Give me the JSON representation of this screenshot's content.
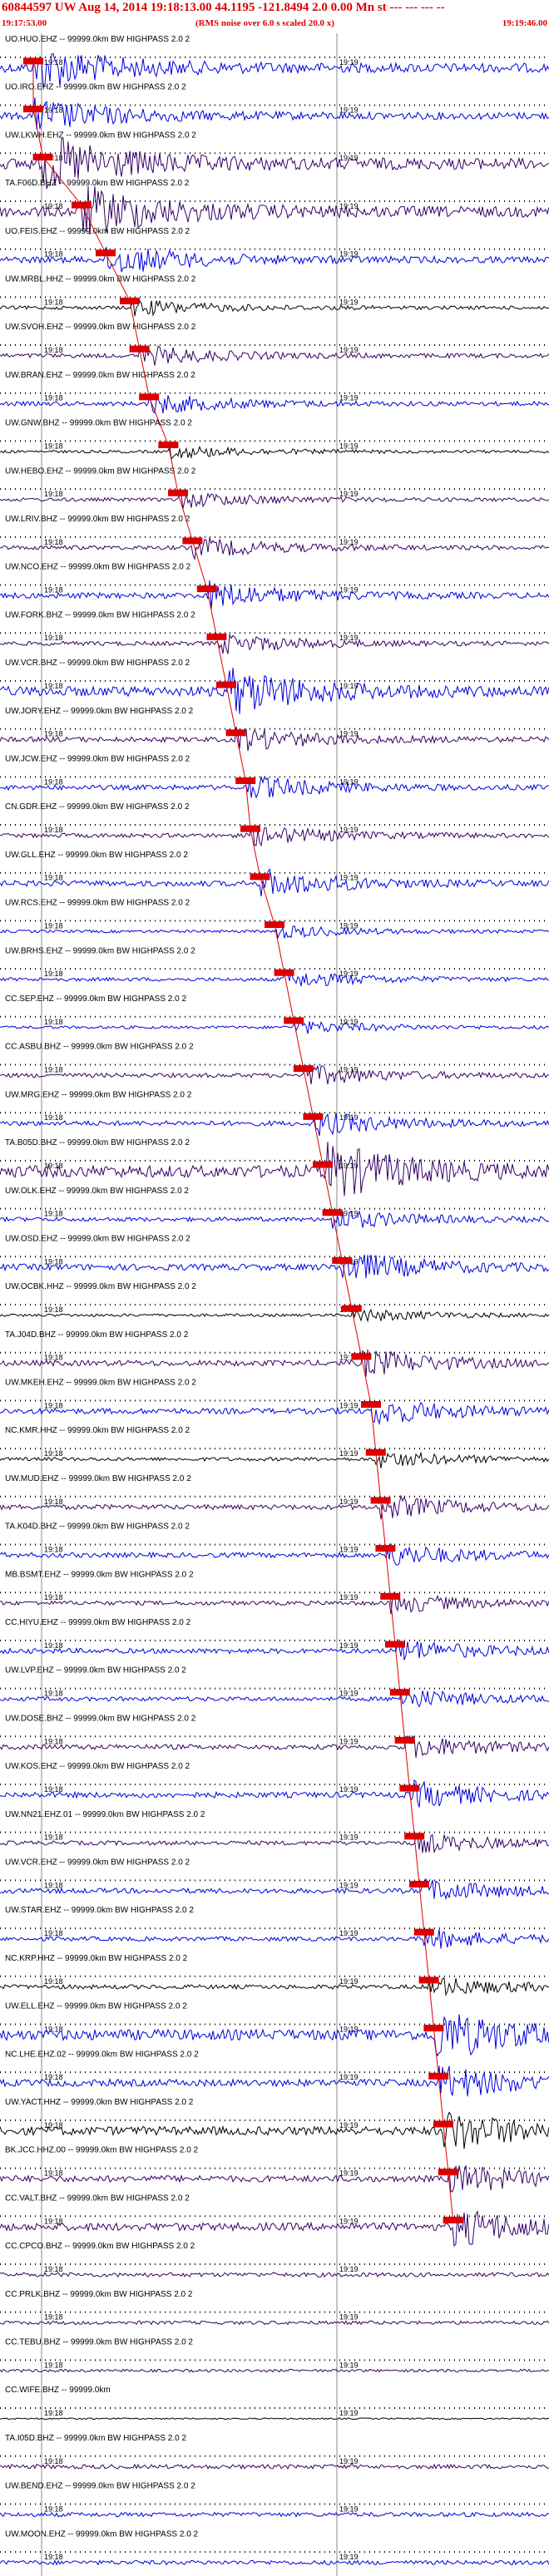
{
  "header": {
    "title": "60844597 UW Aug 14, 2014 19:18:13.00   44.1195 -121.8494  2.0 0.00 Mn st --- --- --- --",
    "start_time": "19:17:53.00",
    "note": "(RMS noise over 6.0 s scaled 20.0 x)",
    "end_time": "19:19:46.00"
  },
  "colors": {
    "header": "#dd0000",
    "pick": "#dd0000",
    "blue": "#0000dd",
    "purple": "#330066",
    "black": "#000000"
  },
  "chart_data": {
    "type": "line",
    "title": "60844597 UW Aug 14, 2014 19:18:13.00   44.1195 -121.8494  2.0 0.00 Mn st --- --- --- --",
    "xlim": [
      "19:17:53.00",
      "19:19:46.00"
    ],
    "tick_labels": [
      "19:18",
      "19:19"
    ],
    "grid": true,
    "series": [
      {
        "label": "UO.HUO.EHZ -- 99999.0km BW  HIGHPASS  2.0  2",
        "color": "blue",
        "amp": 0.65,
        "pick": 0.0
      },
      {
        "label": "UO.IRO.EHZ -- 99999.0km BW  HIGHPASS  2.0  2",
        "color": "blue",
        "amp": 0.5,
        "pick": 0.0
      },
      {
        "label": "UW.LKWH.EHZ -- 99999.0km BW  HIGHPASS  2.0  2",
        "color": "purple",
        "amp": 0.8,
        "pick": 0.02
      },
      {
        "label": "TA.F06D.BHZ -- 99999.0km BW  HIGHPASS  2.0  2",
        "color": "purple",
        "amp": 0.75,
        "pick": 0.1
      },
      {
        "label": "UO.FEIS.EHZ -- 99999.0km BW  HIGHPASS  2.0  2",
        "color": "blue",
        "amp": 0.45,
        "pick": 0.15
      },
      {
        "label": "UW.MRBL.HHZ -- 99999.0km BW  HIGHPASS  2.0  2",
        "color": "black",
        "amp": 0.25,
        "pick": 0.2
      },
      {
        "label": "UW.SVOH.EHZ -- 99999.0km BW  HIGHPASS  2.0  2",
        "color": "purple",
        "amp": 0.3,
        "pick": 0.22
      },
      {
        "label": "UW.BRAN.EHZ -- 99999.0km BW  HIGHPASS  2.0  2",
        "color": "blue",
        "amp": 0.3,
        "pick": 0.24
      },
      {
        "label": "UW.GNW.BHZ -- 99999.0km BW  HIGHPASS  2.0  2",
        "color": "black",
        "amp": 0.2,
        "pick": 0.28
      },
      {
        "label": "UW.HEBO.EHZ -- 99999.0km BW  HIGHPASS  2.0  2",
        "color": "purple",
        "amp": 0.25,
        "pick": 0.3
      },
      {
        "label": "UW.LRIV.BHZ -- 99999.0km BW  HIGHPASS  2.0  2",
        "color": "purple",
        "amp": 0.3,
        "pick": 0.33
      },
      {
        "label": "UW.NCO.EHZ -- 99999.0km BW  HIGHPASS  2.0  2",
        "color": "blue",
        "amp": 0.4,
        "pick": 0.36
      },
      {
        "label": "UW.FORK.BHZ -- 99999.0km BW  HIGHPASS  2.0  2",
        "color": "purple",
        "amp": 0.3,
        "pick": 0.38
      },
      {
        "label": "UW.VCR.BHZ -- 99999.0km BW  HIGHPASS  2.0  2",
        "color": "blue",
        "amp": 0.7,
        "pick": 0.4
      },
      {
        "label": "UW.JORY.EHZ -- 99999.0km BW  HIGHPASS  2.0  2",
        "color": "purple",
        "amp": 0.35,
        "pick": 0.42
      },
      {
        "label": "UW.JCW.EHZ -- 99999.0km BW  HIGHPASS  2.0  2",
        "color": "blue",
        "amp": 0.35,
        "pick": 0.44
      },
      {
        "label": "CN.GDR.EHZ -- 99999.0km BW  HIGHPASS  2.0  2",
        "color": "purple",
        "amp": 0.3,
        "pick": 0.45
      },
      {
        "label": "UW.GLL.EHZ -- 99999.0km BW  HIGHPASS  2.0  2",
        "color": "blue",
        "amp": 0.4,
        "pick": 0.47
      },
      {
        "label": "UW.RCS.EHZ -- 99999.0km BW  HIGHPASS  2.0  2",
        "color": "blue",
        "amp": 0.2,
        "pick": 0.5
      },
      {
        "label": "UW.BRHS.EHZ -- 99999.0km BW  HIGHPASS  2.0  2",
        "color": "blue",
        "amp": 0.25,
        "pick": 0.52
      },
      {
        "label": "CC.SEP.EHZ -- 99999.0km BW  HIGHPASS  2.0  2",
        "color": "blue",
        "amp": 0.2,
        "pick": 0.54
      },
      {
        "label": "CC.ASBU.BHZ -- 99999.0km BW  HIGHPASS  2.0  2",
        "color": "purple",
        "amp": 0.3,
        "pick": 0.56
      },
      {
        "label": "UW.MRG.EHZ -- 99999.0km BW  HIGHPASS  2.0  2",
        "color": "blue",
        "amp": 0.35,
        "pick": 0.58
      },
      {
        "label": "TA.B05D.BHZ -- 99999.0km BW  HIGHPASS  2.0  2",
        "color": "purple",
        "amp": 0.85,
        "pick": 0.6
      },
      {
        "label": "UW.OLK.EHZ -- 99999.0km BW  HIGHPASS  2.0  2",
        "color": "blue",
        "amp": 0.3,
        "pick": 0.62
      },
      {
        "label": "UW.OSD.EHZ -- 99999.0km BW  HIGHPASS  2.0  2",
        "color": "blue",
        "amp": 0.45,
        "pick": 0.64
      },
      {
        "label": "UW.OCBK.HHZ -- 99999.0km BW  HIGHPASS  2.0  2",
        "color": "black",
        "amp": 0.2,
        "pick": 0.66
      },
      {
        "label": "TA.J04D.BHZ -- 99999.0km BW  HIGHPASS  2.0  2",
        "color": "purple",
        "amp": 0.4,
        "pick": 0.68
      },
      {
        "label": "UW.MKEH.EHZ -- 99999.0km BW  HIGHPASS  2.0  2",
        "color": "blue",
        "amp": 0.4,
        "pick": 0.7
      },
      {
        "label": "NC.KMR.HHZ -- 99999.0km BW  HIGHPASS  2.0  2",
        "color": "black",
        "amp": 0.25,
        "pick": 0.71
      },
      {
        "label": "UW.MUD.EHZ -- 99999.0km BW  HIGHPASS  2.0  2",
        "color": "purple",
        "amp": 0.35,
        "pick": 0.72
      },
      {
        "label": "TA.K04D.BHZ -- 99999.0km BW  HIGHPASS  2.0  2",
        "color": "blue",
        "amp": 0.35,
        "pick": 0.73
      },
      {
        "label": "MB.BSMT.EHZ -- 99999.0km BW  HIGHPASS  2.0  2",
        "color": "purple",
        "amp": 0.3,
        "pick": 0.74
      },
      {
        "label": "CC.HIYU.EHZ -- 99999.0km BW  HIGHPASS  2.0  2",
        "color": "blue",
        "amp": 0.35,
        "pick": 0.75
      },
      {
        "label": "UW.LVP.EHZ -- 99999.0km BW  HIGHPASS  2.0  2",
        "color": "blue",
        "amp": 0.3,
        "pick": 0.76
      },
      {
        "label": "UW.DOSE.BHZ -- 99999.0km BW  HIGHPASS  2.0  2",
        "color": "purple",
        "amp": 0.35,
        "pick": 0.77
      },
      {
        "label": "UW.KOS.EHZ -- 99999.0km BW  HIGHPASS  2.0  2",
        "color": "blue",
        "amp": 0.4,
        "pick": 0.78
      },
      {
        "label": "UW.NN21.EHZ.01 -- 99999.0km BW  HIGHPASS  2.0  2",
        "color": "purple",
        "amp": 0.3,
        "pick": 0.79
      },
      {
        "label": "UW.VCR.EHZ -- 99999.0km BW  HIGHPASS  2.0  2",
        "color": "blue",
        "amp": 0.35,
        "pick": 0.8
      },
      {
        "label": "UW.STAR.EHZ -- 99999.0km BW  HIGHPASS  2.0  2",
        "color": "blue",
        "amp": 0.3,
        "pick": 0.81
      },
      {
        "label": "NC.KRP.HHZ -- 99999.0km BW  HIGHPASS  2.0  2",
        "color": "black",
        "amp": 0.3,
        "pick": 0.82
      },
      {
        "label": "UW.ELL.EHZ -- 99999.0km BW  HIGHPASS  2.0  2",
        "color": "blue",
        "amp": 0.75,
        "pick": 0.83
      },
      {
        "label": "NC.LHE.EHZ.02 -- 99999.0km BW  HIGHPASS  2.0  2",
        "color": "blue",
        "amp": 0.5,
        "pick": 0.84
      },
      {
        "label": "UW.YACT.HHZ -- 99999.0km BW  HIGHPASS  2.0  2",
        "color": "black",
        "amp": 0.6,
        "pick": 0.85
      },
      {
        "label": "BK.JCC.HHZ.00 -- 99999.0km BW  HIGHPASS  2.0  2",
        "color": "purple",
        "amp": 0.45,
        "pick": 0.86
      },
      {
        "label": "CC.VALT.BHZ -- 99999.0km BW  HIGHPASS  2.0  2",
        "color": "purple",
        "amp": 0.55,
        "pick": 0.87
      },
      {
        "label": "CC.CPCO.BHZ -- 99999.0km BW  HIGHPASS  2.0  2",
        "color": "purple",
        "amp": 0.3,
        "pick": null
      },
      {
        "label": "CC.PRLK.BHZ -- 99999.0km BW  HIGHPASS  2.0  2",
        "color": "purple",
        "amp": 0.25,
        "pick": null
      },
      {
        "label": "CC.TEBU.BHZ -- 99999.0km BW  HIGHPASS  2.0  2",
        "color": "purple",
        "amp": 0.2,
        "pick": null
      },
      {
        "label": "CC.WIFE.BHZ -- 99999.0km",
        "color": "black",
        "amp": 0.1,
        "pick": null
      },
      {
        "label": "TA.I05D.BHZ -- 99999.0km BW  HIGHPASS  2.0  2",
        "color": "purple",
        "amp": 0.3,
        "pick": null
      },
      {
        "label": "UW.BEND.EHZ -- 99999.0km BW  HIGHPASS  2.0  2",
        "color": "blue",
        "amp": 0.3,
        "pick": null
      },
      {
        "label": "UW.MOON.EHZ -- 99999.0km BW  HIGHPASS  2.0  2",
        "color": "blue",
        "amp": 0.3,
        "pick": null
      }
    ]
  }
}
